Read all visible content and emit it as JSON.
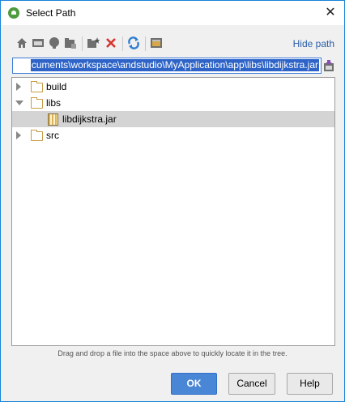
{
  "window": {
    "title": "Select Path",
    "close_glyph": "✕"
  },
  "toolbar": {
    "icons": [
      "home-icon",
      "desktop-icon",
      "project-icon",
      "module-icon",
      "new-folder-icon",
      "delete-icon",
      "refresh-icon",
      "show-hidden-icon"
    ],
    "hide_path_label": "Hide path"
  },
  "path": {
    "value": "cuments\\workspace\\andstudio\\MyApplication\\app\\libs\\libdijkstra.jar"
  },
  "tree": {
    "items": [
      {
        "label": "build",
        "type": "folder",
        "expanded": false,
        "selected": false
      },
      {
        "label": "libs",
        "type": "folder",
        "expanded": true,
        "selected": false
      },
      {
        "label": "libdijkstra.jar",
        "type": "jar",
        "selected": true
      },
      {
        "label": "src",
        "type": "folder",
        "expanded": false,
        "selected": false
      }
    ]
  },
  "hint": "Drag and drop a file into the space above to quickly locate it in the tree.",
  "buttons": {
    "ok": "OK",
    "cancel": "Cancel",
    "help": "Help"
  },
  "colors": {
    "accent": "#4a86d6",
    "selection": "#2e64c7",
    "link": "#2a5ea8",
    "delete": "#d8322c"
  }
}
